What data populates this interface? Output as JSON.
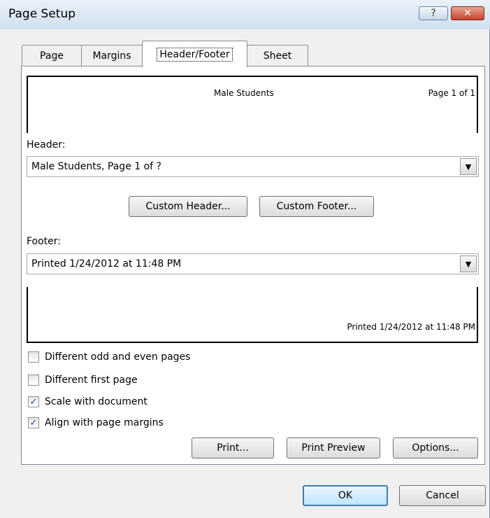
{
  "window": {
    "title": "Page Setup",
    "help_label": "?",
    "close_label": "✕"
  },
  "tabs": [
    {
      "label": "Page",
      "active": false
    },
    {
      "label": "Margins",
      "active": false
    },
    {
      "label": "Header/Footer",
      "active": true
    },
    {
      "label": "Sheet",
      "active": false
    }
  ],
  "header_preview": {
    "center": "Male Students",
    "right": "Page 1 of 1"
  },
  "header": {
    "label": "Header:",
    "value": "Male Students, Page 1 of ?"
  },
  "buttons": {
    "custom_header": "Custom Header...",
    "custom_footer": "Custom Footer..."
  },
  "footer": {
    "label": "Footer:",
    "value": "Printed 1/24/2012 at 11:48 PM"
  },
  "footer_preview": {
    "right": "Printed 1/24/2012 at 11:48 PM"
  },
  "options": [
    {
      "label": "Different odd and even pages",
      "checked": false
    },
    {
      "label": "Different first page",
      "checked": false
    },
    {
      "label": "Scale with document",
      "checked": true
    },
    {
      "label": "Align with page margins",
      "checked": true
    }
  ],
  "actions": {
    "print": "Print...",
    "print_preview": "Print Preview",
    "options": "Options..."
  },
  "dialog": {
    "ok": "OK",
    "cancel": "Cancel"
  },
  "icons": {
    "dropdown": "chevron-down-icon",
    "check": "checkmark-icon"
  }
}
